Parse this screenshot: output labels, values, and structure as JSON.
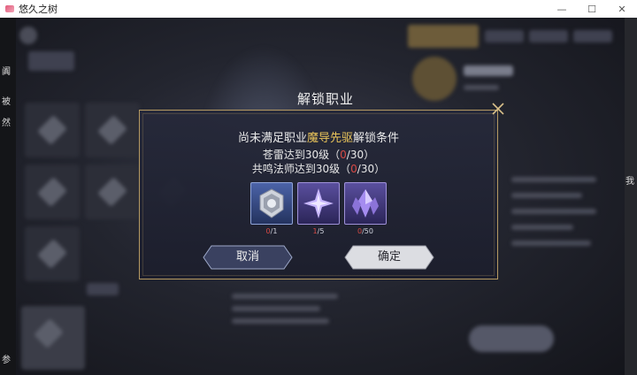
{
  "window": {
    "title": "悠久之树",
    "minimize_glyph": "—",
    "maximize_glyph": "☐",
    "close_glyph": "✕"
  },
  "side_text": {
    "left": [
      "阗",
      "被",
      "然",
      "参"
    ],
    "right": [
      "我"
    ]
  },
  "dialog": {
    "title": "解锁职业",
    "message_prefix": "尚未满足职业",
    "class_name": "魔导先驱",
    "message_suffix": "解锁条件",
    "conditions": [
      {
        "text": "苍雷达到30级（",
        "current": "0",
        "target": "/30）"
      },
      {
        "text": "共鸣法师达到30级（",
        "current": "0",
        "target": "/30）"
      }
    ],
    "items": [
      {
        "icon": "silver-emblem-icon",
        "have": "0",
        "need": "/1"
      },
      {
        "icon": "violet-crystal-star-icon",
        "have": "1",
        "need": "/5"
      },
      {
        "icon": "violet-crystal-cluster-icon",
        "have": "0",
        "need": "/50"
      }
    ],
    "cancel_label": "取消",
    "confirm_label": "确定"
  },
  "colors": {
    "highlight": "#e9c45a",
    "insufficient": "#d74a45",
    "border_gold": "#b69a62"
  }
}
